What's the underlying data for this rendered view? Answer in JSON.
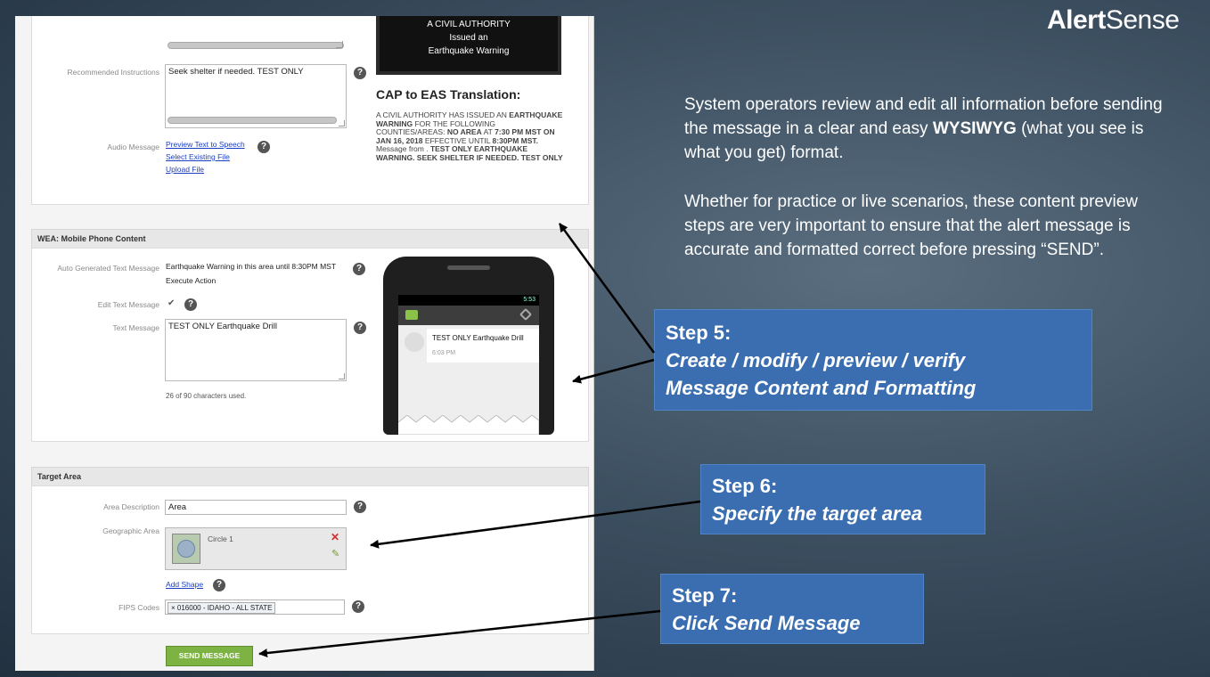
{
  "brand": {
    "bold": "Alert",
    "light": "Sense"
  },
  "info": {
    "p1_pre": "System operators review and edit all information before sending the message in a clear and easy ",
    "p1_bold": "WYSIWYG",
    "p1_post": " (what you see is what you get)  format.",
    "p2": "Whether for practice or live scenarios, these content preview steps are very important to ensure that the alert message is accurate and formatted correct before pressing “SEND”."
  },
  "steps": [
    {
      "title": "Step 5:",
      "line1": "Create / modify / preview / verify",
      "line2": "Message Content and Formatting"
    },
    {
      "title": "Step 6:",
      "line1": "Specify the target area"
    },
    {
      "title": "Step 7:",
      "line1": "Click Send Message"
    }
  ],
  "eas": {
    "preview_lines": [
      "A CIVIL AUTHORITY",
      "Issued an",
      "Earthquake Warning"
    ],
    "recommended_label": "Recommended Instructions",
    "recommended_value": "Seek shelter if needed.  TEST ONLY",
    "audio_label": "Audio Message",
    "audio_links": [
      "Preview Text to Speech",
      "Select Existing File",
      "Upload File"
    ],
    "translation_title": "CAP to EAS Translation:",
    "translation_text": {
      "t1": "A CIVIL AUTHORITY HAS ISSUED AN ",
      "b1": "EARTHQUAKE WARNING",
      "t2": " FOR THE FOLLOWING COUNTIES/AREAS: ",
      "b2": "NO AREA",
      "t3": " AT ",
      "b3": "7:30 PM MST ON JAN 16, 2018",
      "t4": " EFFECTIVE UNTIL ",
      "b4": "8:30PM MST.",
      "t5": " Message from . ",
      "b5": "TEST ONLY EARTHQUAKE WARNING. SEEK SHELTER IF NEEDED. TEST ONLY"
    }
  },
  "wea": {
    "header": "WEA: Mobile Phone Content",
    "auto_label": "Auto Generated Text Message",
    "auto_value": "Earthquake Warning in this area until 8:30PM MST",
    "auto_sub": "Execute Action",
    "edit_label": "Edit Text Message",
    "edit_check": "✔",
    "text_label": "Text Message",
    "text_value": "TEST ONLY Earthquake Drill",
    "char_count": "26 of 90 characters used.",
    "phone_time": "5:53",
    "phone_message": "TEST ONLY Earthquake Drill",
    "phone_msg_time": "6:03 PM"
  },
  "target": {
    "header": "Target Area",
    "area_desc_label": "Area Description",
    "area_desc_value": "Area",
    "geo_label": "Geographic Area",
    "shape_name": "Circle 1",
    "add_shape": "Add Shape",
    "fips_label": "FIPS Codes",
    "fips_token": "× 016000 - IDAHO - ALL STATE"
  },
  "send_button": "SEND MESSAGE",
  "help_glyph": "?",
  "colors": {
    "step_box": "#3a6eb0",
    "send_button": "#7cb342",
    "link": "#1a3fc4"
  }
}
